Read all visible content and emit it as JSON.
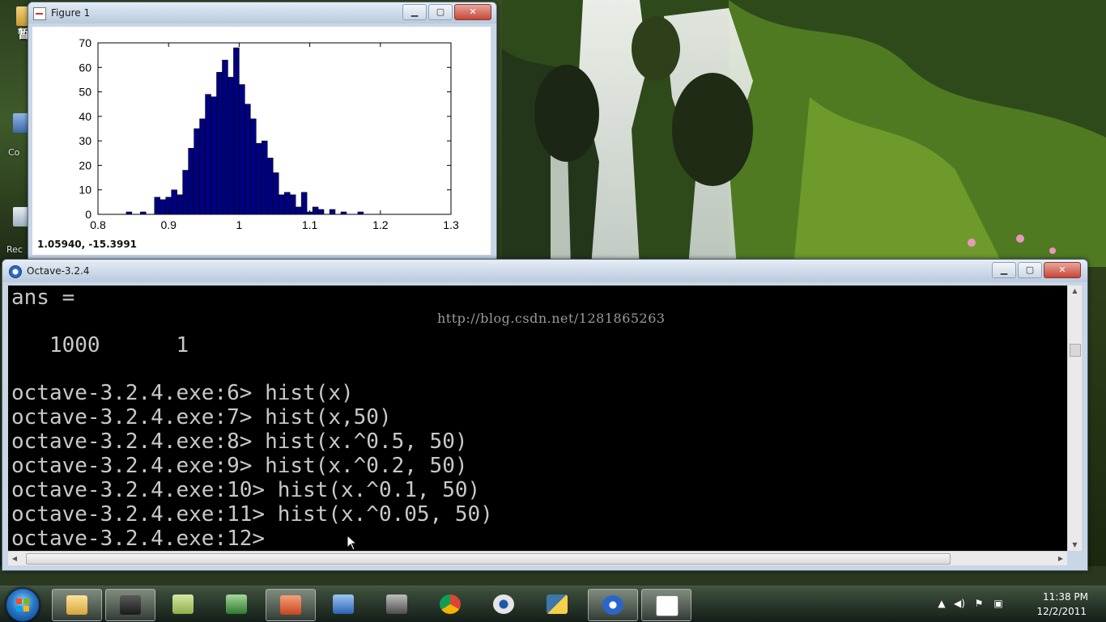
{
  "desktop": {
    "pause_label": "暂停",
    "icon_labels": [
      "Co",
      "Rec"
    ]
  },
  "figure_window": {
    "title": "Figure 1",
    "min_glyph": "▁",
    "max_glyph": "▢",
    "close_glyph": "✕",
    "coordinate_readout": "1.05940, -15.3991"
  },
  "chart_data": {
    "type": "bar",
    "title": "",
    "xlabel": "",
    "ylabel": "",
    "xlim": [
      0.8,
      1.3
    ],
    "ylim": [
      0,
      70
    ],
    "xticks": [
      "0.8",
      "0.9",
      "1",
      "1.1",
      "1.2",
      "1.3"
    ],
    "yticks": [
      "0",
      "10",
      "20",
      "30",
      "40",
      "50",
      "60",
      "70"
    ],
    "bar_color": "#00007f",
    "bin_width": 0.008,
    "bin_left_edges": [
      0.84,
      0.852,
      0.86,
      0.872,
      0.88,
      0.888,
      0.896,
      0.904,
      0.912,
      0.92,
      0.928,
      0.936,
      0.944,
      0.952,
      0.96,
      0.968,
      0.976,
      0.984,
      0.992,
      1.0,
      1.008,
      1.016,
      1.024,
      1.032,
      1.04,
      1.048,
      1.056,
      1.064,
      1.072,
      1.08,
      1.088,
      1.096,
      1.104,
      1.112,
      1.12,
      1.128,
      1.136,
      1.144,
      1.152,
      1.16,
      1.168
    ],
    "counts": [
      1,
      0,
      1,
      0,
      7,
      6,
      7,
      10,
      8,
      18,
      27,
      35,
      39,
      49,
      48,
      58,
      63,
      56,
      68,
      53,
      45,
      39,
      29,
      30,
      23,
      17,
      8,
      9,
      8,
      3,
      9,
      1,
      3,
      2,
      0,
      2,
      0,
      1,
      0,
      0,
      1
    ]
  },
  "octave_window": {
    "title": "Octave-3.2.4",
    "min_glyph": "▁",
    "max_glyph": "▢",
    "close_glyph": "✕",
    "watermark": "http://blog.csdn.net/1281865263",
    "console_lines": [
      "ans =",
      "",
      "   1000      1",
      "",
      "octave-3.2.4.exe:6> hist(x)",
      "octave-3.2.4.exe:7> hist(x,50)",
      "octave-3.2.4.exe:8> hist(x.^0.5, 50)",
      "octave-3.2.4.exe:9> hist(x.^0.2, 50)",
      "octave-3.2.4.exe:10> hist(x.^0.1, 50)",
      "octave-3.2.4.exe:11> hist(x.^0.05, 50)",
      "octave-3.2.4.exe:12> "
    ]
  },
  "taskbar": {
    "apps": [
      "explorer",
      "camcorder",
      "notepad",
      "network-tool",
      "powerpoint",
      "network-connections",
      "camera",
      "chrome",
      "webcam",
      "python",
      "octave",
      "figure"
    ],
    "clock_time": "11:38 PM",
    "clock_date": "12/2/2011"
  }
}
